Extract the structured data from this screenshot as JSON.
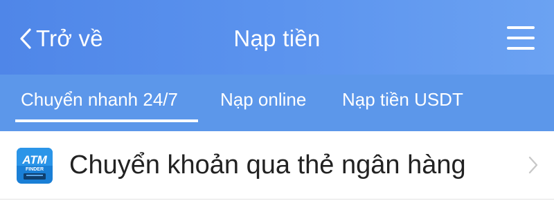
{
  "header": {
    "back_label": "Trở về",
    "title": "Nạp tiền",
    "back_icon": "chevron-left-icon",
    "menu_icon": "hamburger-menu-icon"
  },
  "tabs": [
    {
      "label": "Chuyển nhanh 24/7",
      "active": true
    },
    {
      "label": "Nạp online",
      "active": false
    },
    {
      "label": "Nạp tiền USDT",
      "active": false
    }
  ],
  "rows": [
    {
      "icon": "atm-finder-icon",
      "icon_text": "ATM",
      "icon_subtext": "FINDER",
      "label": "Chuyển khoản qua thẻ ngân hàng",
      "chevron_icon": "chevron-right-icon"
    }
  ],
  "colors": {
    "header_bg": "#5b93ee",
    "tabbar_bg": "#5c97ea",
    "icon_bg": "#1a7fd6",
    "text_primary": "#222222",
    "chevron": "#c8c8c8"
  }
}
